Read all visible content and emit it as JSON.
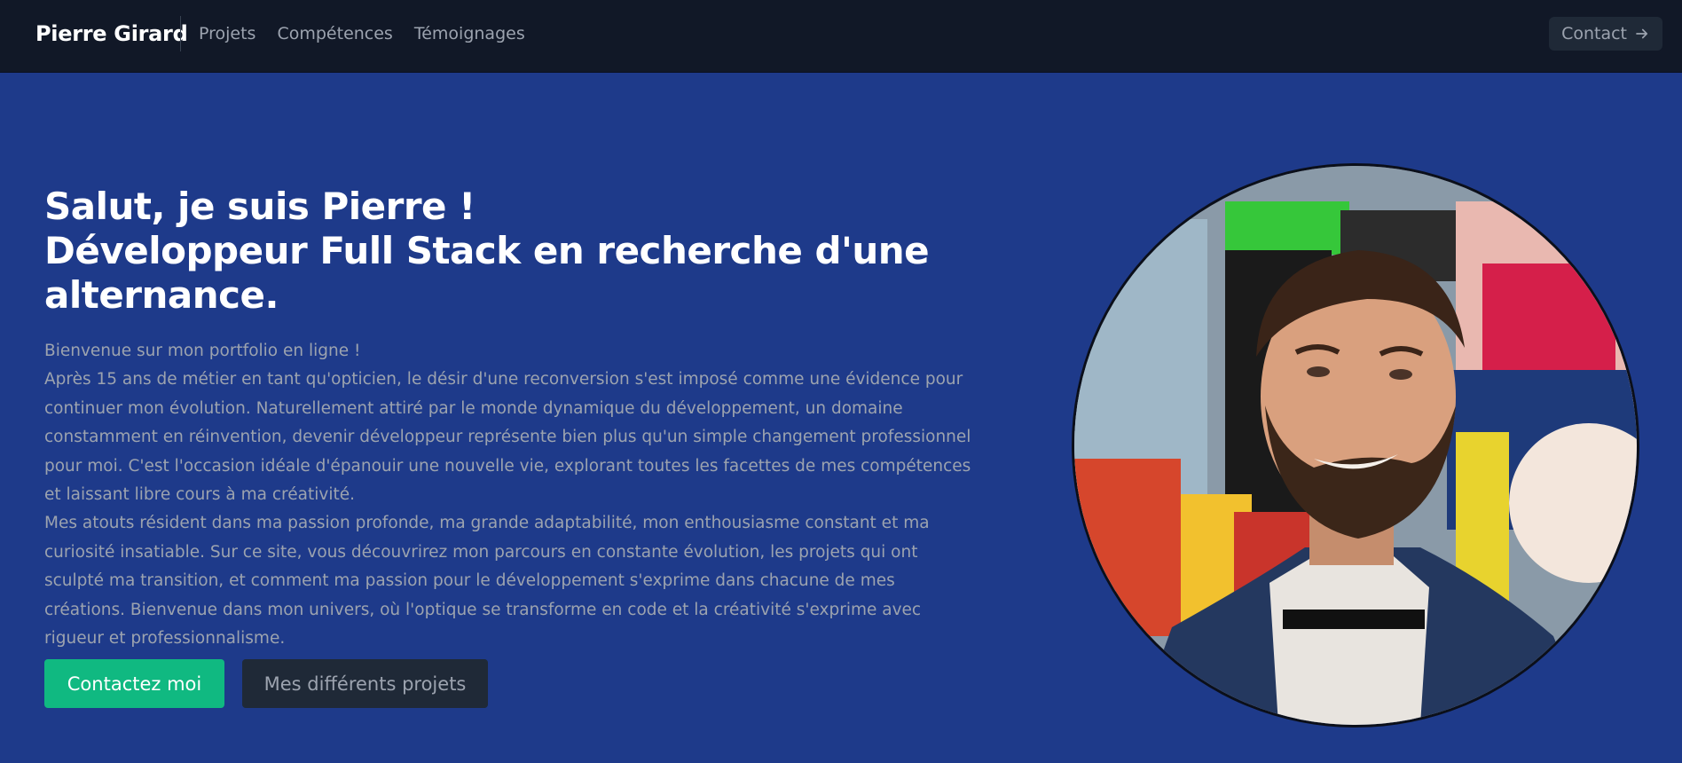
{
  "nav": {
    "brand": "Pierre Girard",
    "links": [
      "Projets",
      "Compétences",
      "Témoignages"
    ],
    "contact_label": "Contact",
    "contact_icon": "arrow-right-icon"
  },
  "hero": {
    "title_lines": [
      "Salut, je suis Pierre !",
      "Développeur Full Stack en recherche d'une",
      "alternance."
    ],
    "paragraphs": [
      "Bienvenue sur mon portfolio en ligne !",
      "Après 15 ans de métier en tant qu'opticien, le désir d'une reconversion s'est imposé comme une évidence pour continuer mon évolution. Naturellement attiré par le monde dynamique du développement, un domaine constamment en réinvention, devenir développeur représente bien plus qu'un simple changement professionnel pour moi. C'est l'occasion idéale d'épanouir une nouvelle vie, explorant toutes les facettes de mes compétences et laissant libre cours à ma créativité.",
      "Mes atouts résident dans ma passion profonde, ma grande adaptabilité, mon enthousiasme constant et ma curiosité insatiable. Sur ce site, vous découvrirez mon parcours en constante évolution, les projets qui ont sculpté ma transition, et comment ma passion pour le développement s'exprime dans chacune de mes créations. Bienvenue dans mon univers, où l'optique se transforme en code et la créativité s'exprime avec rigueur et professionnalisme."
    ],
    "primary_button": "Contactez moi",
    "secondary_button": "Mes différents projets"
  },
  "colors": {
    "navbar_bg": "#111827",
    "hero_bg": "#1e3a8a",
    "primary": "#10b981",
    "secondary_btn": "#1f2937",
    "muted_text": "#9ca3af"
  }
}
